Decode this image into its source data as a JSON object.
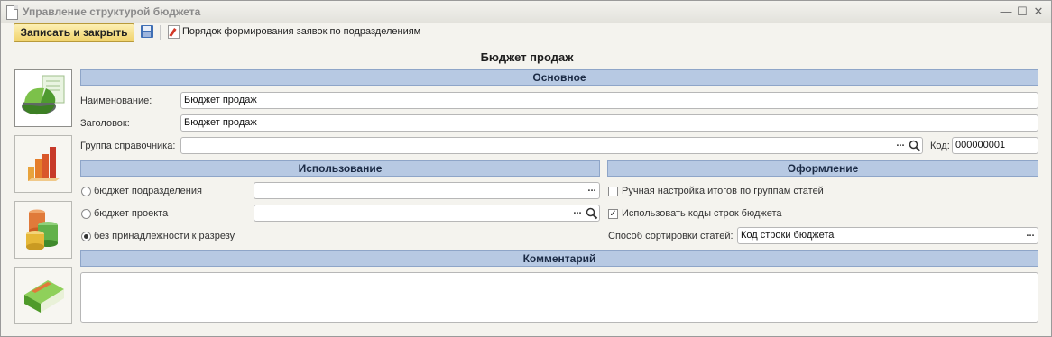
{
  "window": {
    "title": "Управление структурой бюджета"
  },
  "toolbar": {
    "save_close_label": "Записать и закрыть",
    "order_link_label": "Порядок формирования заявок по подразделениям"
  },
  "form": {
    "title": "Бюджет продаж"
  },
  "side_tabs": [
    {
      "icon": "budget-pie-chart-icon"
    },
    {
      "icon": "bar-chart-icon"
    },
    {
      "icon": "database-cylinders-icon"
    },
    {
      "icon": "green-book-icon"
    }
  ],
  "main": {
    "header": "Основное",
    "name_label": "Наименование:",
    "name_value": "Бюджет продаж",
    "heading_label": "Заголовок:",
    "heading_value": "Бюджет продаж",
    "group_label": "Группа справочника:",
    "group_value": "",
    "code_label": "Код:",
    "code_value": "000000001"
  },
  "usage": {
    "header": "Использование",
    "options": [
      {
        "label": "бюджет подразделения",
        "selected": false,
        "value": ""
      },
      {
        "label": "бюджет проекта",
        "selected": false,
        "value": ""
      },
      {
        "label": "без принадлежности к разрезу",
        "selected": true
      }
    ]
  },
  "design": {
    "header": "Оформление",
    "manual_totals_label": "Ручная настройка итогов по группам статей",
    "manual_totals_checked": false,
    "use_codes_label": "Использовать коды строк бюджета",
    "use_codes_checked": true,
    "sort_label": "Способ сортировки статей:",
    "sort_value": "Код строки бюджета"
  },
  "comment": {
    "header": "Комментарий",
    "value": ""
  },
  "colors": {
    "section_header_bg": "#b7c9e3",
    "save_button_bg": "#f0d26a"
  }
}
